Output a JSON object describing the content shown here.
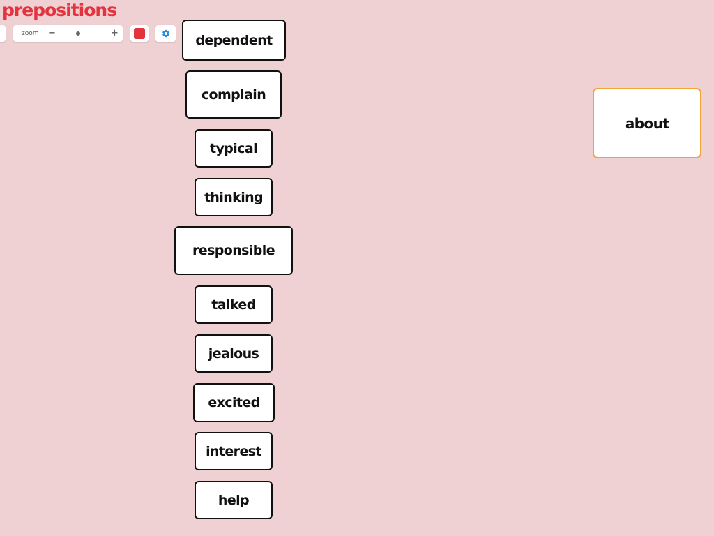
{
  "app": {
    "title": "prepositions"
  },
  "toolbar": {
    "zoom_label": "zoom",
    "zoom_minus": "−",
    "zoom_plus": "+",
    "zoom_level_fraction": 0.38,
    "color_button_color": "#e3343e",
    "settings_icon": "gear-icon"
  },
  "cards": [
    {
      "label": "dependent"
    },
    {
      "label": "complain"
    },
    {
      "label": "typical"
    },
    {
      "label": "thinking"
    },
    {
      "label": "responsible"
    },
    {
      "label": "talked"
    },
    {
      "label": "jealous"
    },
    {
      "label": "excited"
    },
    {
      "label": "interest"
    },
    {
      "label": "help"
    }
  ],
  "target_card": {
    "label": "about",
    "border_color": "#f0a534"
  },
  "colors": {
    "background": "#efd0d3",
    "title": "#e3343e",
    "card_border": "#111111"
  }
}
